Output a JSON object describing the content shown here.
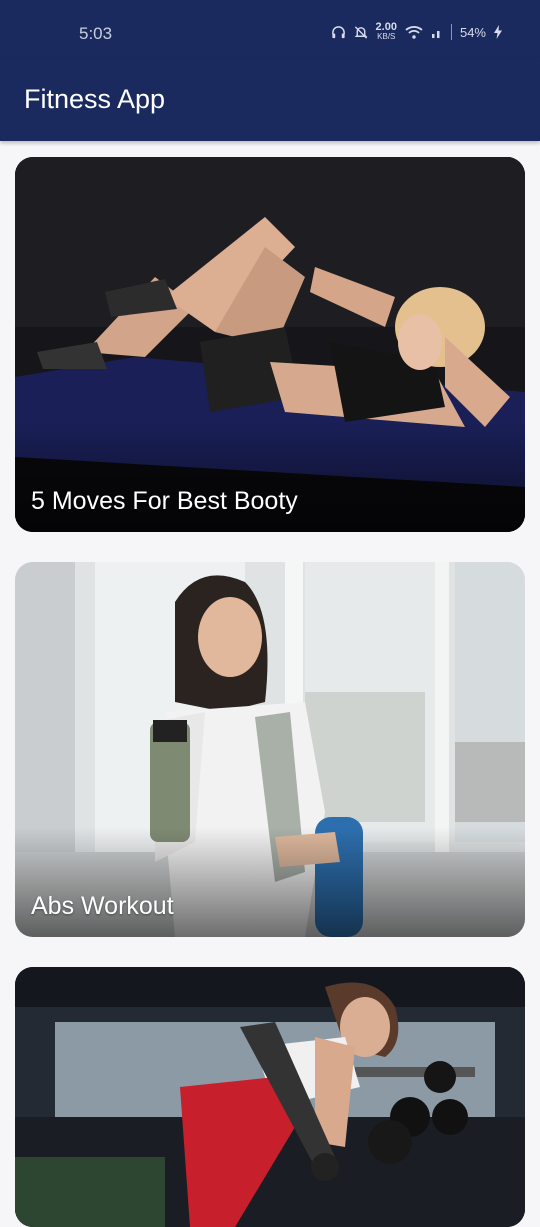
{
  "status_bar": {
    "time": "5:03",
    "net_speed": "2.00",
    "net_unit": "KB/S",
    "battery": "54%"
  },
  "app_bar": {
    "title": "Fitness App"
  },
  "workouts": [
    {
      "title": "5 Moves For Best Booty",
      "image": "woman-doing-crunches-on-mat"
    },
    {
      "title": "Abs Workout",
      "image": "woman-with-shaker-and-yoga-mat"
    },
    {
      "title": "",
      "image": "woman-lifting-dumbbell-in-gym"
    }
  ],
  "colors": {
    "primary": "#1a2a5e",
    "background": "#f6f6f8",
    "card_text": "#ffffff"
  }
}
